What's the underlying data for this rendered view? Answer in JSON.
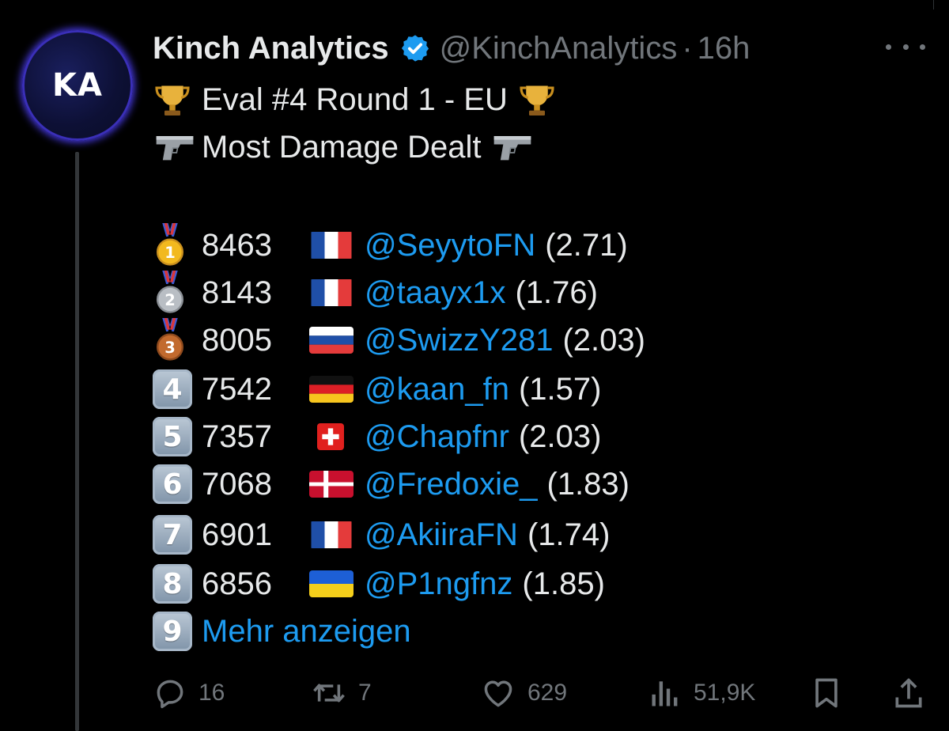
{
  "author": {
    "avatar_text": "KA",
    "name": "Kinch Analytics",
    "handle": "@KinchAnalytics",
    "separator": "·",
    "time": "16h"
  },
  "post": {
    "title_line": "Eval #4 Round 1 - EU",
    "title_icon": "trophy-icon",
    "subtitle_line": "Most Damage Dealt",
    "subtitle_icon": "pistol-icon",
    "rankings": [
      {
        "rank": "1",
        "rank_icon": "gold-medal-icon",
        "value": "8463",
        "flag": "france",
        "user": "@SeyytoFN",
        "ratio": "(2.71)"
      },
      {
        "rank": "2",
        "rank_icon": "silver-medal-icon",
        "value": "8143",
        "flag": "france",
        "user": "@taayx1x",
        "ratio": "(1.76)"
      },
      {
        "rank": "3",
        "rank_icon": "bronze-medal-icon",
        "value": "8005",
        "flag": "russia",
        "user": "@SwizzY281",
        "ratio": "(2.03)"
      },
      {
        "rank": "4",
        "rank_icon": "keycap-4-icon",
        "value": "7542",
        "flag": "germany",
        "user": "@kaan_fn",
        "ratio": "(1.57)"
      },
      {
        "rank": "5",
        "rank_icon": "keycap-5-icon",
        "value": "7357",
        "flag": "switzerland",
        "user": "@Chapfnr",
        "ratio": "(2.03)"
      },
      {
        "rank": "6",
        "rank_icon": "keycap-6-icon",
        "value": "7068",
        "flag": "denmark",
        "user": "@Fredoxie_",
        "ratio": "(1.83)"
      },
      {
        "rank": "7",
        "rank_icon": "keycap-7-icon",
        "value": "6901",
        "flag": "france",
        "user": "@AkiiraFN",
        "ratio": "(1.74)"
      },
      {
        "rank": "8",
        "rank_icon": "keycap-8-icon",
        "value": "6856",
        "flag": "ukraine",
        "user": "@P1ngfnz",
        "ratio": "(1.85)"
      }
    ],
    "show_more": {
      "rank": "9",
      "label": "Mehr anzeigen"
    }
  },
  "actions": {
    "replies": "16",
    "reposts": "7",
    "likes": "629",
    "views": "51,9K"
  },
  "colors": {
    "background": "#000000",
    "text": "#e7e9ea",
    "muted": "#71767b",
    "link": "#1d9bf0",
    "verified": "#1d9bf0"
  }
}
